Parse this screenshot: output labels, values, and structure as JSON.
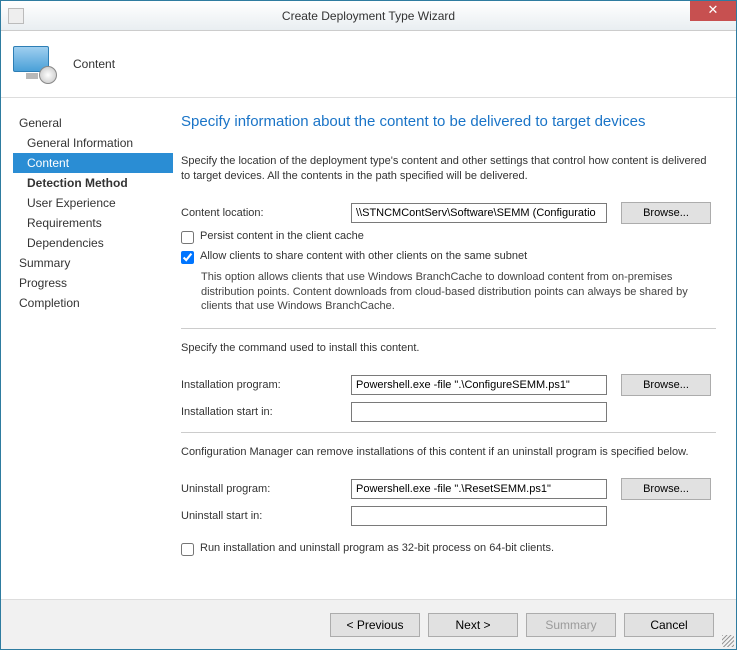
{
  "window": {
    "title": "Create Deployment Type Wizard",
    "close_glyph": "✕"
  },
  "header": {
    "step_title": "Content"
  },
  "sidebar": {
    "items": [
      {
        "label": "General",
        "kind": "top"
      },
      {
        "label": "General Information",
        "kind": "sub"
      },
      {
        "label": "Content",
        "kind": "sub",
        "active": true
      },
      {
        "label": "Detection Method",
        "kind": "sub",
        "bold": true
      },
      {
        "label": "User Experience",
        "kind": "sub"
      },
      {
        "label": "Requirements",
        "kind": "sub"
      },
      {
        "label": "Dependencies",
        "kind": "sub"
      },
      {
        "label": "Summary",
        "kind": "top"
      },
      {
        "label": "Progress",
        "kind": "top"
      },
      {
        "label": "Completion",
        "kind": "top"
      }
    ]
  },
  "main": {
    "heading": "Specify information about the content to be delivered to target devices",
    "intro": "Specify the location of the deployment type's content and other settings that control how content is delivered to target devices. All the contents in the path specified will be delivered.",
    "content_location_label": "Content location:",
    "content_location_value": "\\\\STNCMContServ\\Software\\SEMM (Configuratio",
    "browse_label": "Browse...",
    "persist_label": "Persist content in the client cache",
    "persist_checked": false,
    "allow_share_label": "Allow clients to share content with other clients on the same subnet",
    "allow_share_checked": true,
    "branchcache_hint": "This option allows clients that use Windows BranchCache to download content from on-premises distribution points. Content downloads from cloud-based distribution points can always be shared by clients that use Windows BranchCache.",
    "install_section_text": "Specify the command used to install this content.",
    "install_program_label": "Installation program:",
    "install_program_value": "Powershell.exe -file \".\\ConfigureSEMM.ps1\"",
    "install_start_label": "Installation start in:",
    "install_start_value": "",
    "uninstall_section_text": "Configuration Manager can remove installations of this content if an uninstall program is specified below.",
    "uninstall_program_label": "Uninstall program:",
    "uninstall_program_value": "Powershell.exe -file \".\\ResetSEMM.ps1\"",
    "uninstall_start_label": "Uninstall start in:",
    "uninstall_start_value": "",
    "run32_label": "Run installation and uninstall program as 32-bit process on 64-bit clients.",
    "run32_checked": false
  },
  "footer": {
    "previous": "< Previous",
    "next": "Next >",
    "summary": "Summary",
    "cancel": "Cancel"
  }
}
